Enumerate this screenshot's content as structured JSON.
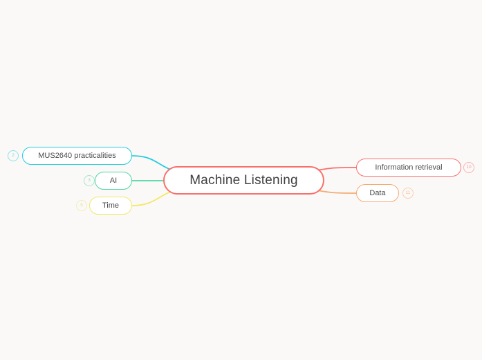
{
  "theme": {
    "background": "#faf9f8",
    "root_color": "#f9706b",
    "text_color": "#4a4a4a"
  },
  "mindmap": {
    "root": {
      "label": "Machine Listening",
      "color": "#f9706b"
    },
    "branches": [
      {
        "id": "mus2640",
        "label": "MUS2640 practicalities",
        "color": "#22cddc",
        "badge": "2",
        "side": "left"
      },
      {
        "id": "ai",
        "label": "AI",
        "color": "#4fd6a5",
        "badge": "3",
        "side": "left"
      },
      {
        "id": "time",
        "label": "Time",
        "color": "#f2e868",
        "badge": "5",
        "side": "left"
      },
      {
        "id": "information-retrieval",
        "label": "Information retrieval",
        "color": "#f9706b",
        "badge": "10",
        "side": "right"
      },
      {
        "id": "data",
        "label": "Data",
        "color": "#f5ab72",
        "badge": "11",
        "side": "right"
      }
    ]
  }
}
